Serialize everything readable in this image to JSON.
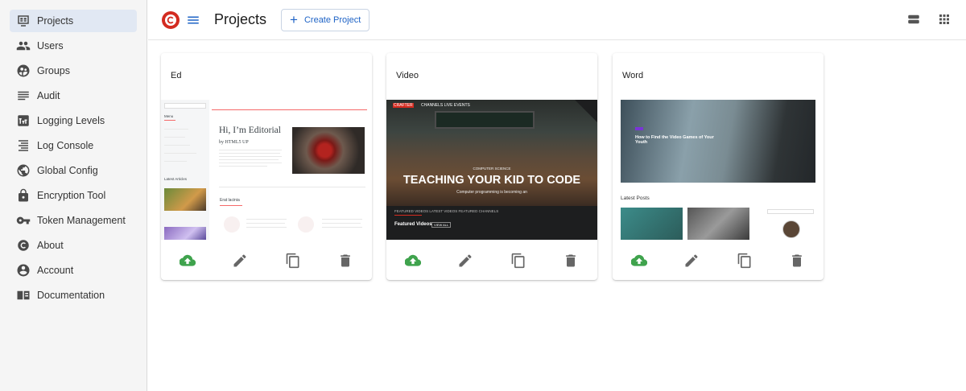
{
  "sidebar": {
    "items": [
      {
        "label": "Projects",
        "icon": "projects-icon",
        "active": true
      },
      {
        "label": "Users",
        "icon": "users-icon"
      },
      {
        "label": "Groups",
        "icon": "groups-icon"
      },
      {
        "label": "Audit",
        "icon": "audit-icon"
      },
      {
        "label": "Logging Levels",
        "icon": "logging-levels-icon"
      },
      {
        "label": "Log Console",
        "icon": "log-console-icon"
      },
      {
        "label": "Global Config",
        "icon": "globe-icon"
      },
      {
        "label": "Encryption Tool",
        "icon": "lock-icon"
      },
      {
        "label": "Token Management",
        "icon": "key-icon"
      },
      {
        "label": "About",
        "icon": "crafter-icon"
      },
      {
        "label": "Account",
        "icon": "account-icon"
      },
      {
        "label": "Documentation",
        "icon": "documentation-icon"
      }
    ]
  },
  "header": {
    "title": "Projects",
    "create_label": "Create Project",
    "accent_color": "#1e63c6",
    "logo_color": "#d32b20"
  },
  "cards": [
    {
      "title": "Ed",
      "thumb": {
        "heading": "Hi, I’m Editorial",
        "byline": "by HTML5 UP",
        "section": "Erat lacinia",
        "menu": "Menu",
        "latest": "Latest Articles"
      }
    },
    {
      "title": "Video",
      "thumb": {
        "brand": "CRAFTER",
        "nav": "CHANNELS    LIVE EVENTS",
        "kicker": "COMPUTER SCIENCE",
        "headline": "TEACHING YOUR KID TO CODE",
        "caption": "Computer programming is becoming an",
        "tabs": "FEATURED VIDEOS    LATEST VIDEOS    FEATURED CHANNELS",
        "featured": "Featured Videos",
        "view_all": "VIEW ALL"
      }
    },
    {
      "title": "Word",
      "thumb": {
        "hero_title": "How to Find the Video Games of Your Youth",
        "latest": "Latest Posts"
      }
    }
  ],
  "card_actions": {
    "publish_icon": "cloud-upload-icon",
    "edit_icon": "pencil-icon",
    "duplicate_icon": "copy-icon",
    "delete_icon": "trash-icon",
    "publish_color": "#3fa34d"
  }
}
